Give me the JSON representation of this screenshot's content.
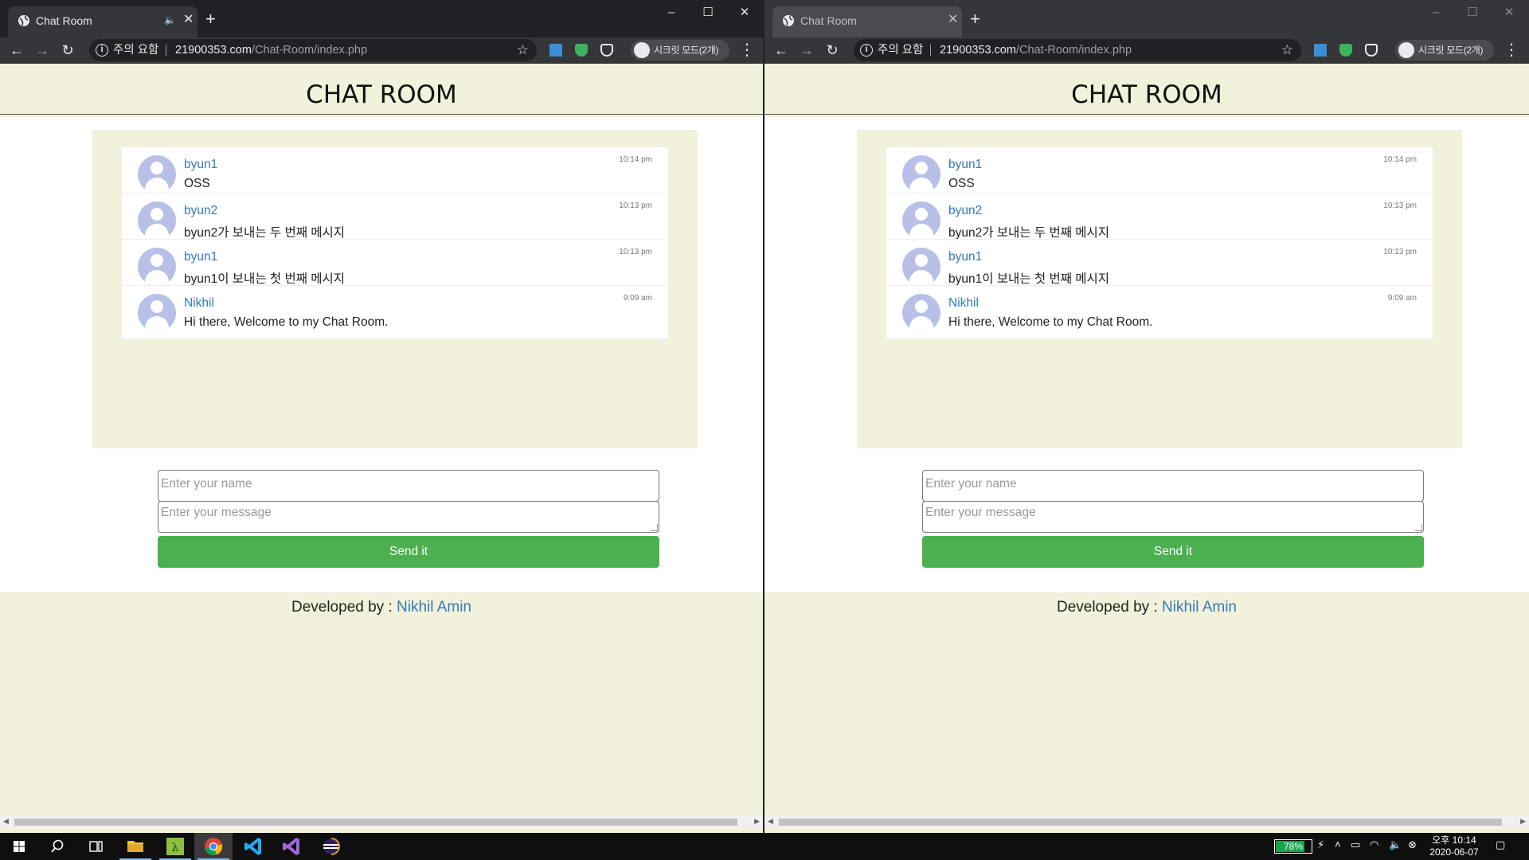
{
  "browser": {
    "tab_title": "Chat Room",
    "security_warning": "주의 요함",
    "url_host": "21900353.com",
    "url_path": "/Chat-Room/index.php",
    "incognito_label": "시크릿 모드(2개)"
  },
  "page": {
    "title": "CHAT ROOM",
    "messages": [
      {
        "user": "byun1",
        "text": "OSS",
        "time": "10:14 pm"
      },
      {
        "user": "byun2",
        "text": "byun2가 보내는 두 번째 메시지",
        "time": "10:13 pm"
      },
      {
        "user": "byun1",
        "text": "byun1이 보내는 첫 번째 메시지",
        "time": "10:13 pm"
      },
      {
        "user": "Nikhil",
        "text": "Hi there, Welcome to my Chat Room.",
        "time": "9:09 am"
      }
    ],
    "form": {
      "name_placeholder": "Enter your name",
      "message_placeholder": "Enter your message",
      "send_label": "Send it"
    },
    "footer": {
      "prefix": "Developed by : ",
      "author": "Nikhil Amin"
    }
  },
  "taskbar": {
    "battery": "78%",
    "battery_level": 0.78,
    "time": "오후 10:14",
    "date": "2020-06-07"
  },
  "colors": {
    "page_bg": "#f2f2dc",
    "link": "#337ab7",
    "send_button": "#4caf50",
    "avatar": "#b9c0e8"
  }
}
